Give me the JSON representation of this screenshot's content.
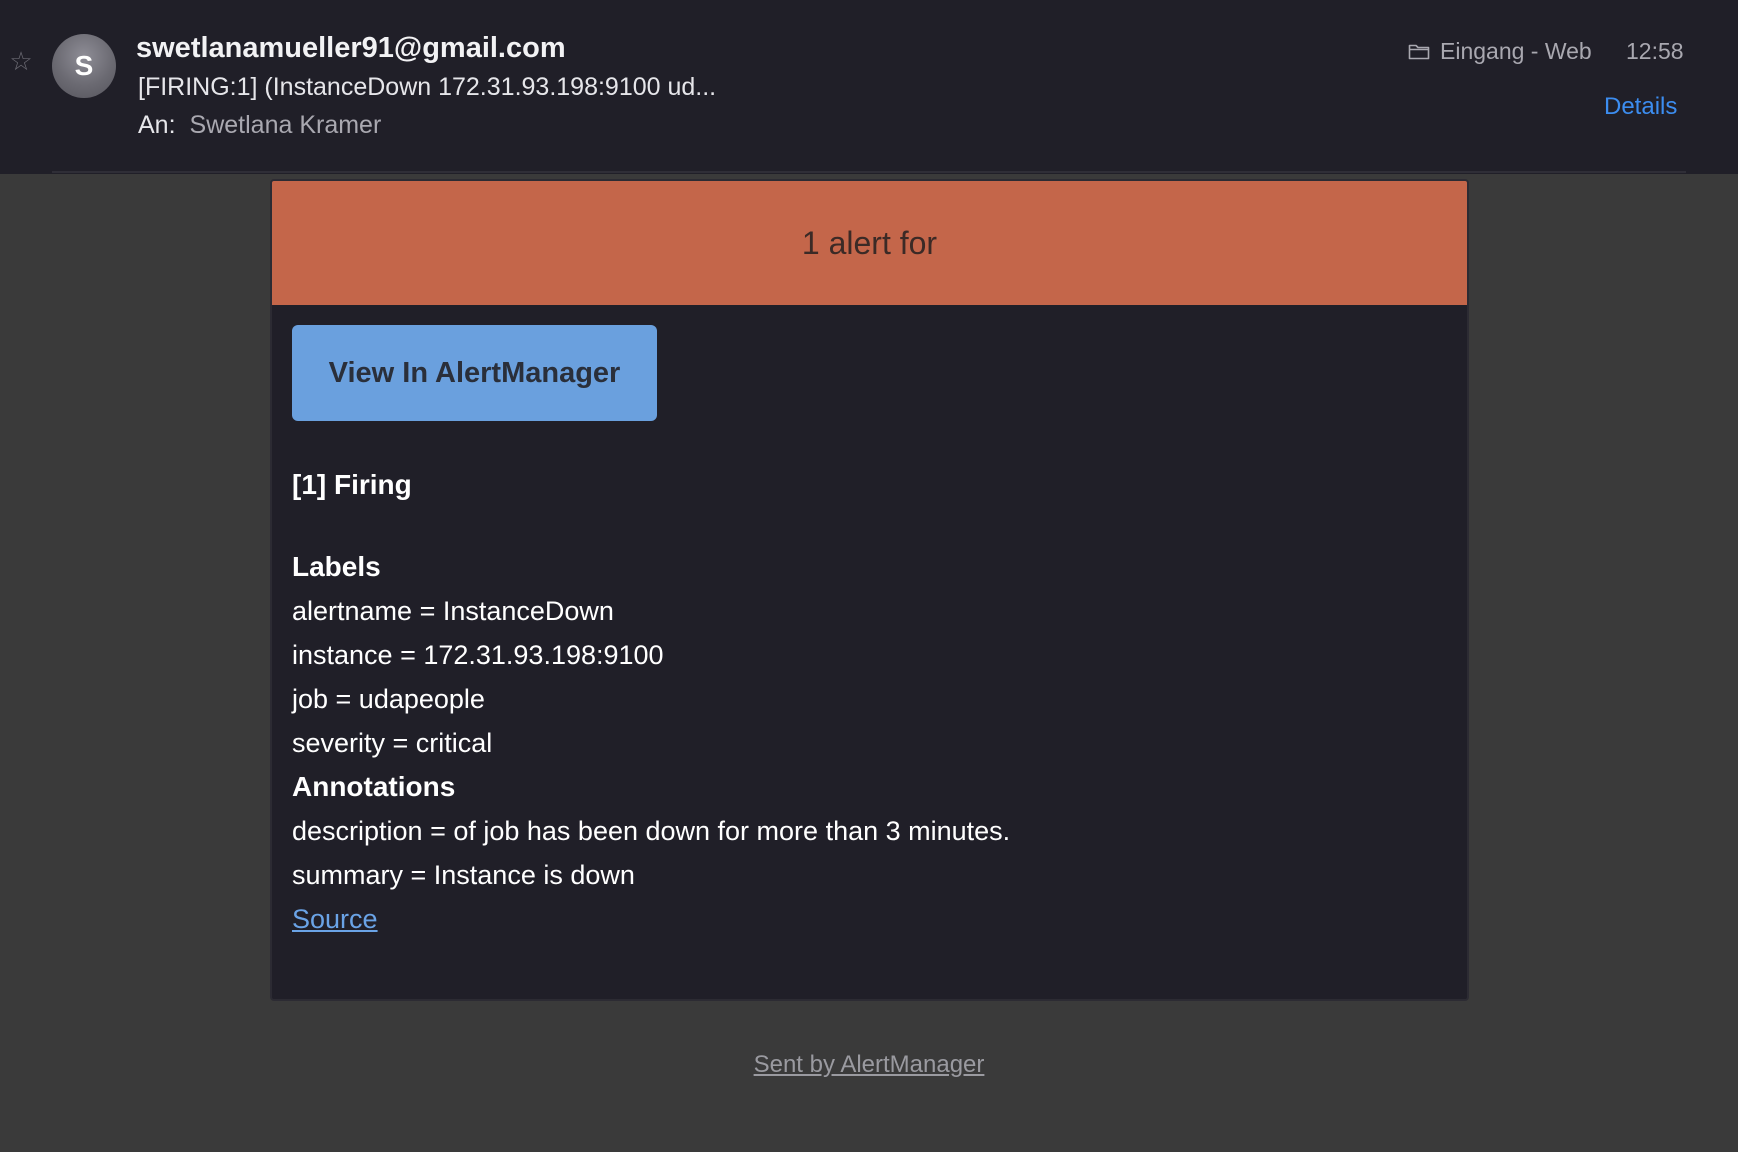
{
  "header": {
    "avatar_initial": "S",
    "sender": "swetlanamueller91@gmail.com",
    "subject": "[FIRING:1]  (InstanceDown 172.31.93.198:9100 ud...",
    "to_label": "An:",
    "to_name": "Swetlana Kramer",
    "folder": "Eingang - Web",
    "time": "12:58",
    "details_label": "Details",
    "star_icon": "star-outline-icon",
    "folder_icon": "folder-icon"
  },
  "alert": {
    "banner_title": "1 alert for",
    "view_button_label": "View In AlertManager",
    "firing_title": "[1] Firing",
    "labels_title": "Labels",
    "labels": [
      "alertname = InstanceDown",
      "instance = 172.31.93.198:9100",
      "job = udapeople",
      "severity = critical"
    ],
    "annotations_title": "Annotations",
    "annotations": [
      "description = of job has been down for more than 3 minutes.",
      "summary = Instance is down"
    ],
    "source_label": "Source"
  },
  "footer": {
    "sent_by_label": "Sent by AlertManager"
  },
  "colors": {
    "banner": "#c4664a",
    "button": "#6aa0de",
    "link": "#3c8df0",
    "header_bg": "#201f28",
    "page_bg": "#3a3a3a"
  }
}
